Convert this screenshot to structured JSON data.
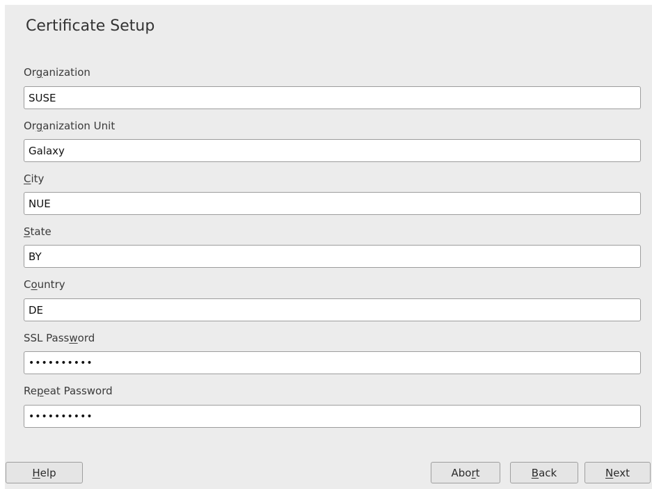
{
  "page": {
    "title": "Certificate Setup"
  },
  "fields": [
    {
      "label_pre": "Or",
      "label_key": "g",
      "label_post": "anization",
      "value": "SUSE",
      "type": "text"
    },
    {
      "label_pre": "Or",
      "label_key": "g",
      "label_post": "anization Unit",
      "value": "Galaxy",
      "type": "text"
    },
    {
      "label_pre": "",
      "label_key": "C",
      "label_post": "ity",
      "value": "NUE",
      "type": "text"
    },
    {
      "label_pre": "",
      "label_key": "S",
      "label_post": "tate",
      "value": "BY",
      "type": "text"
    },
    {
      "label_pre": "C",
      "label_key": "o",
      "label_post": "untry",
      "value": "DE",
      "type": "text"
    },
    {
      "label_pre": "SSL Pass",
      "label_key": "w",
      "label_post": "ord",
      "value": "••••••••••",
      "type": "password"
    },
    {
      "label_pre": "Re",
      "label_key": "p",
      "label_post": "eat Password",
      "value": "••••••••••",
      "type": "password"
    }
  ],
  "buttons": {
    "help": {
      "pre": "",
      "key": "H",
      "post": "elp"
    },
    "abort": {
      "pre": "Abo",
      "key": "r",
      "post": "t"
    },
    "back": {
      "pre": "",
      "key": "B",
      "post": "ack"
    },
    "next": {
      "pre": "",
      "key": "N",
      "post": "ext"
    }
  }
}
